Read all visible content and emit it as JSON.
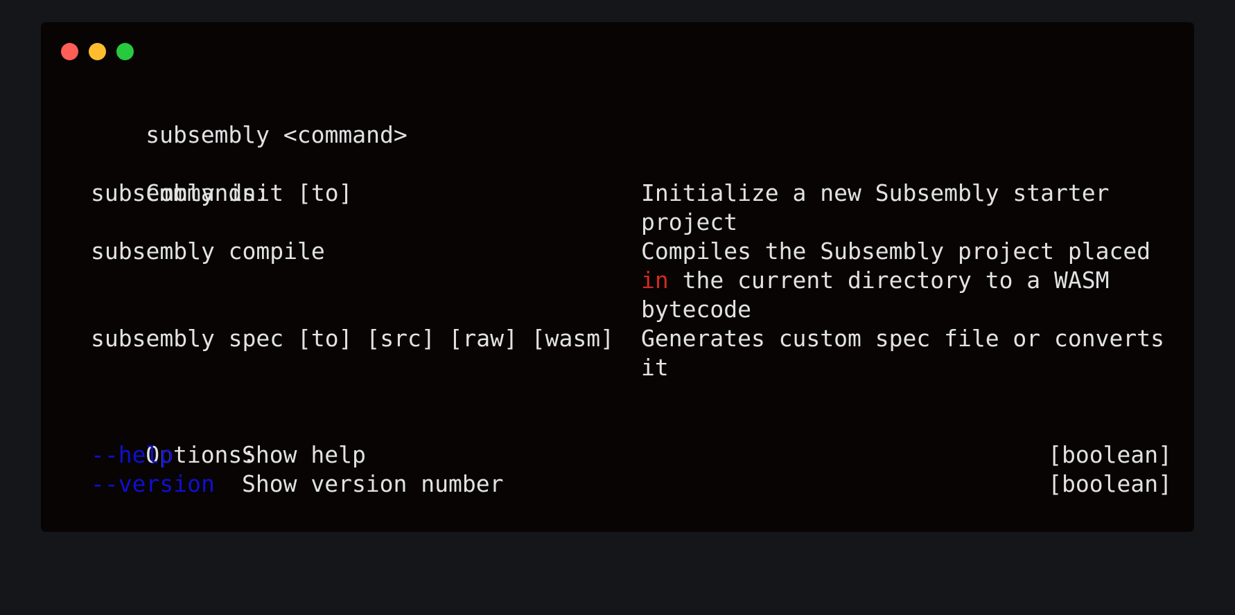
{
  "window": {
    "traffic_lights": [
      "close",
      "minimize",
      "zoom"
    ]
  },
  "terminal": {
    "usage": "subsembly <command>",
    "commands_header": "Commands:",
    "commands": [
      {
        "name": "subsembly init [to]",
        "desc_lines": [
          "Initialize a new Subsembly starter",
          "project"
        ]
      },
      {
        "name": "subsembly compile",
        "desc_line1": "Compiles the Subsembly project placed",
        "desc_line2_keyword": "in",
        "desc_line2_rest": " the current directory to a WASM",
        "desc_line3": "bytecode"
      },
      {
        "name": "subsembly spec [to] [src] [raw] [wasm]",
        "desc_lines": [
          "Generates custom spec file or converts",
          "it"
        ]
      }
    ],
    "options_header": "Options:",
    "options": [
      {
        "flag": "--help",
        "desc": "Show help",
        "type": "[boolean]"
      },
      {
        "flag": "--version",
        "desc": "Show version number",
        "type": "[boolean]"
      }
    ]
  },
  "colors": {
    "page_bg": "#151619",
    "window_bg": "#080404",
    "text": "#e2e2e2",
    "flag": "#0f0fd0",
    "keyword": "#d22a1e"
  }
}
